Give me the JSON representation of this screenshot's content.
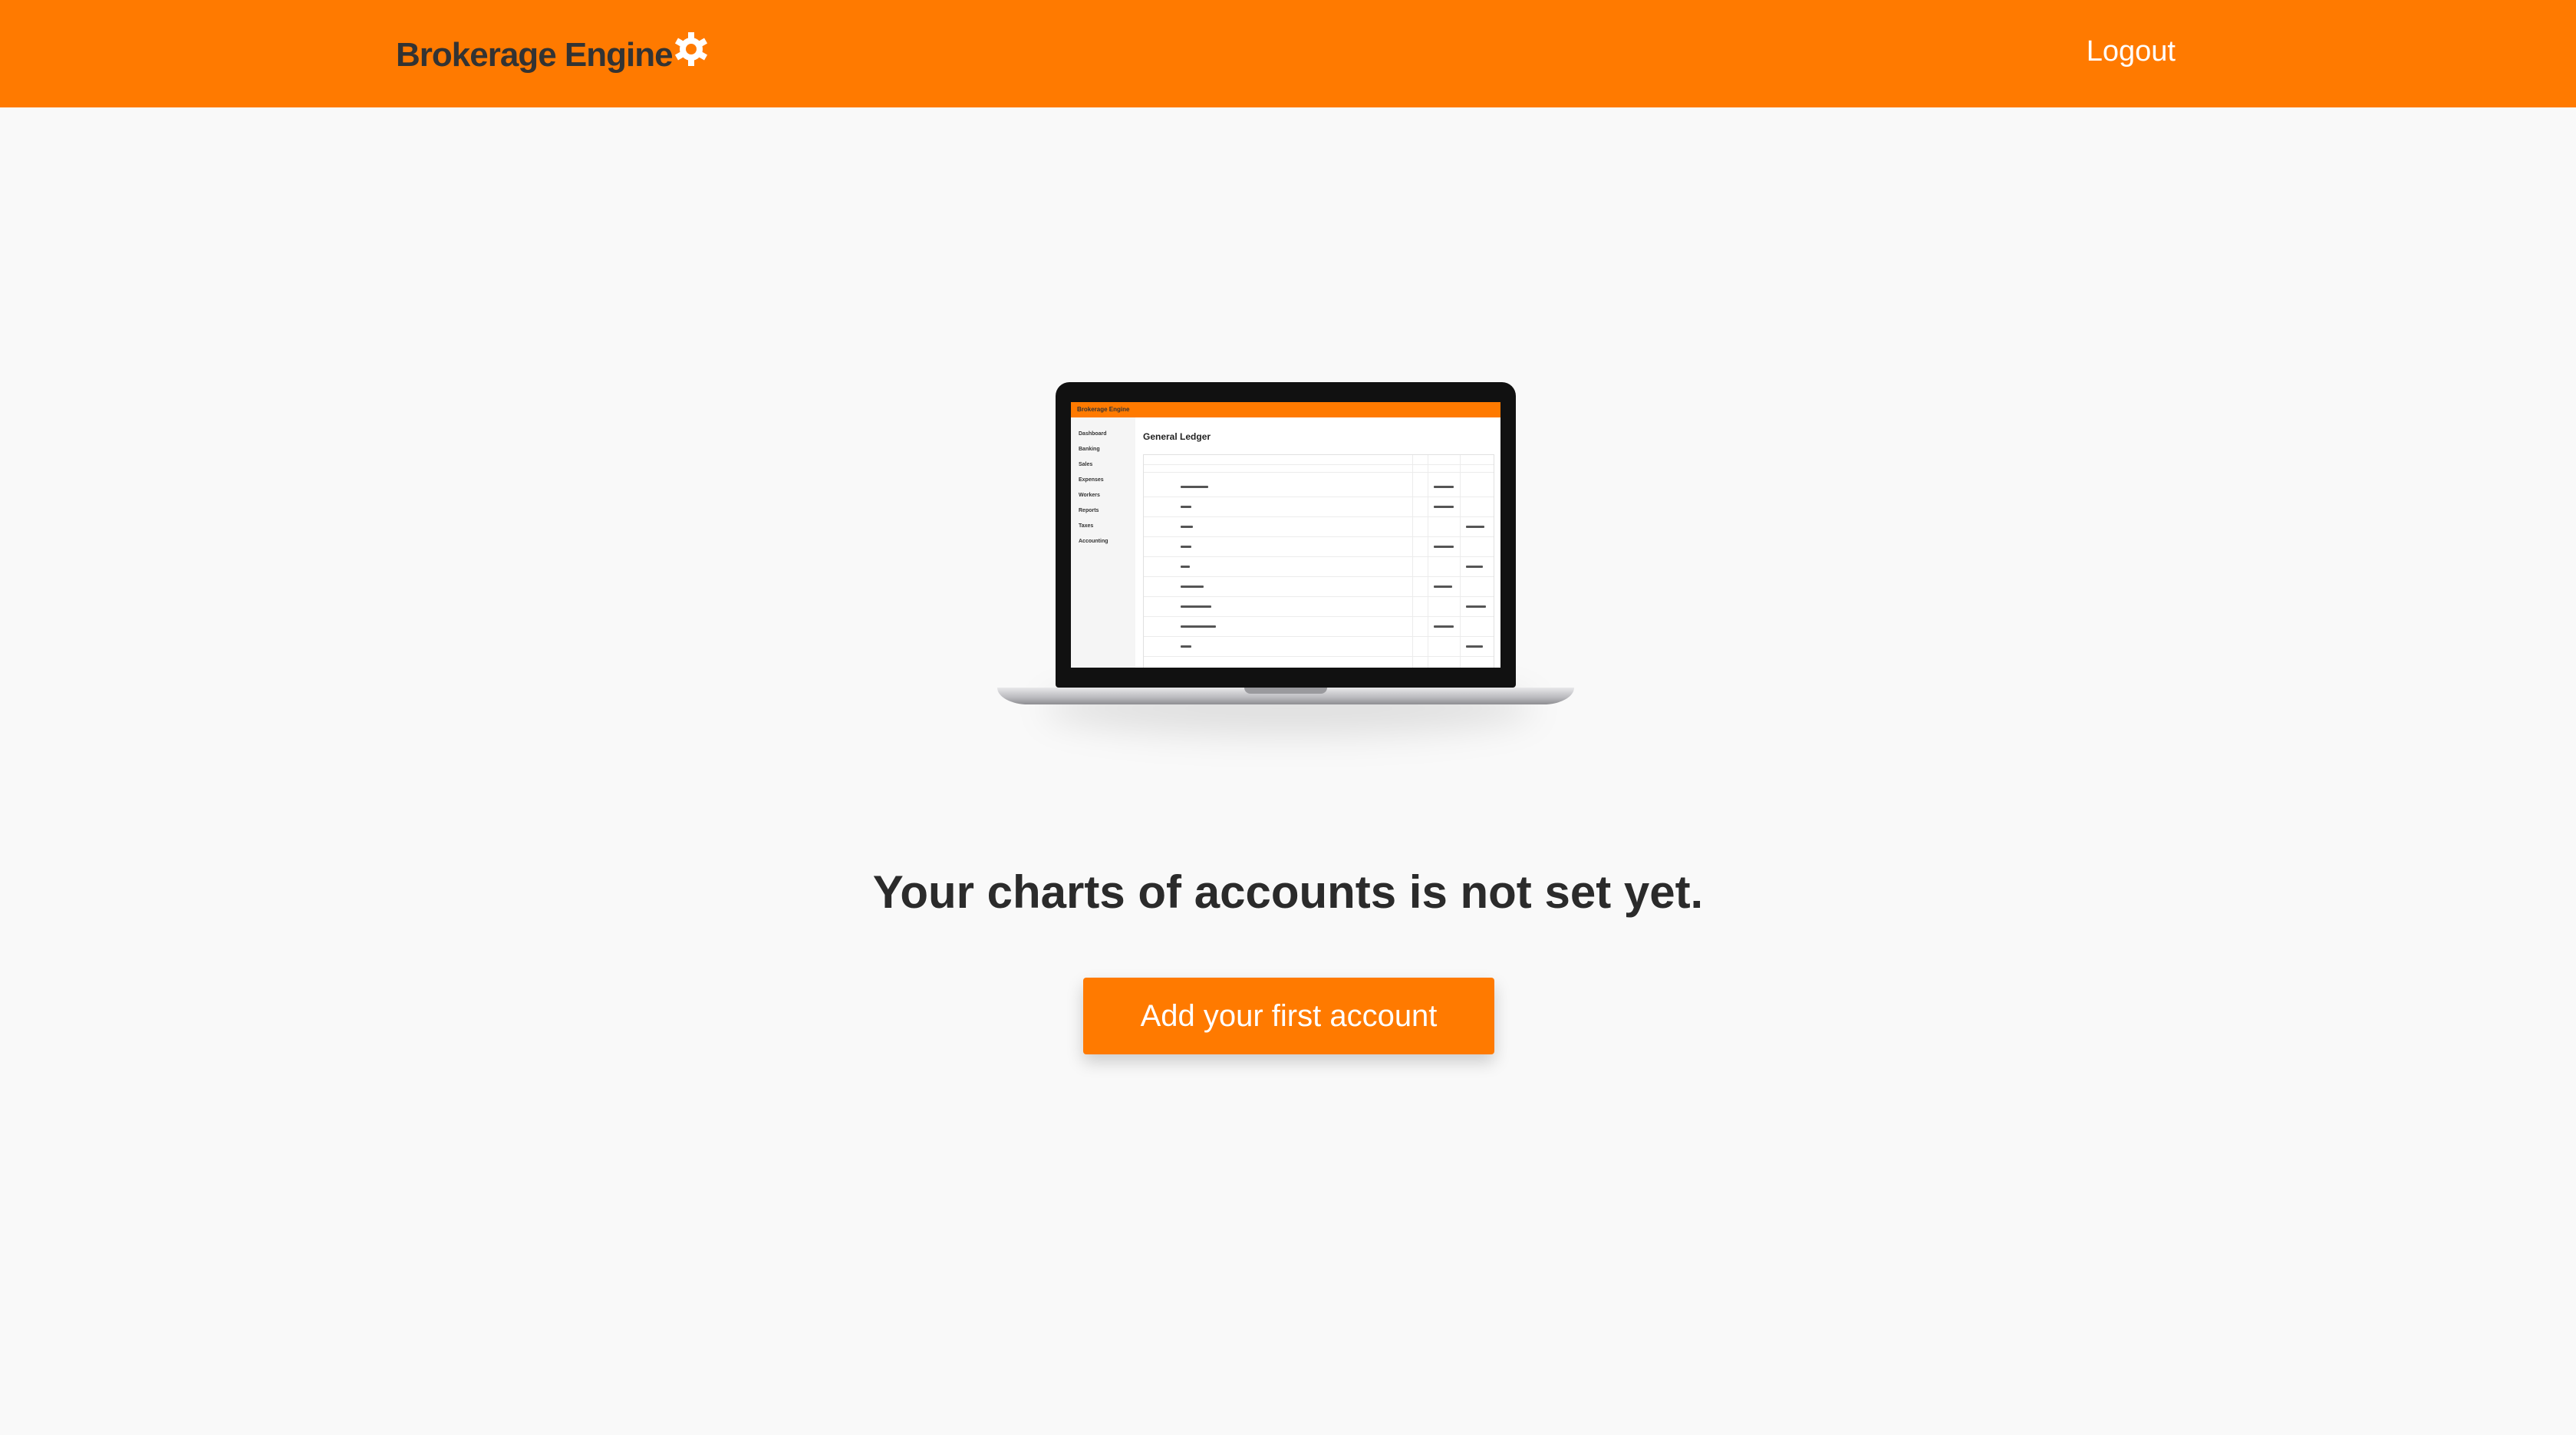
{
  "header": {
    "brand": "Brokerage Engine",
    "brand_icon": "gear-logo-icon",
    "logout_label": "Logout",
    "background_color": "#ff7a00"
  },
  "illustration": {
    "icon": "laptop-illustration",
    "screen": {
      "brand": "Brokerage Engine",
      "title": "General Ledger",
      "sidebar_items": [
        "Dashboard",
        "Banking",
        "Sales",
        "Expenses",
        "Workers",
        "Reports",
        "Taxes",
        "Accounting"
      ]
    }
  },
  "main": {
    "message": "Your charts of accounts is not set yet.",
    "cta_label": "Add your first account",
    "accent_color": "#ff7a00"
  }
}
